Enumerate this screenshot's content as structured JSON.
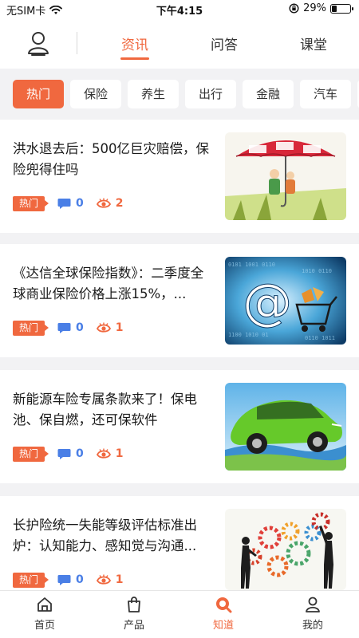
{
  "status_bar": {
    "carrier": "无SIM卡",
    "time": "下午4:15",
    "battery": "29%",
    "battery_level": 0.29
  },
  "top_tabs": [
    {
      "label": "资讯",
      "active": true
    },
    {
      "label": "问答",
      "active": false
    },
    {
      "label": "课堂",
      "active": false
    }
  ],
  "categories": [
    {
      "label": "热门",
      "active": true
    },
    {
      "label": "保险",
      "active": false
    },
    {
      "label": "养生",
      "active": false
    },
    {
      "label": "出行",
      "active": false
    },
    {
      "label": "金融",
      "active": false
    },
    {
      "label": "汽车",
      "active": false
    }
  ],
  "articles": [
    {
      "title": "洪水退去后：500亿巨灾赔偿，保险兜得住吗",
      "tag": "热门",
      "comments": "0",
      "views": "2",
      "thumb": "umbrella-insurance-cartoon"
    },
    {
      "title": "《达信全球保险指数》：二季度全球商业保险价格上涨15%，...",
      "tag": "热门",
      "comments": "0",
      "views": "1",
      "thumb": "at-sign-shopping-cart"
    },
    {
      "title": "新能源车险专属条款来了！保电池、保自燃，还可保软件",
      "tag": "热门",
      "comments": "0",
      "views": "1",
      "thumb": "green-electric-car"
    },
    {
      "title": "长护险统一失能等级评估标准出炉：认知能力、感知觉与沟通...",
      "tag": "热门",
      "comments": "0",
      "views": "1",
      "thumb": "people-with-gears"
    }
  ],
  "bottom_nav": [
    {
      "label": "首页",
      "icon": "home-icon",
      "active": false
    },
    {
      "label": "产品",
      "icon": "bag-icon",
      "active": false
    },
    {
      "label": "知道",
      "icon": "search-knowledge-icon",
      "active": true
    },
    {
      "label": "我的",
      "icon": "profile-icon",
      "active": false
    }
  ],
  "colors": {
    "accent": "#f0683f",
    "comment": "#4a7fe6",
    "background": "#f2f2f4"
  }
}
